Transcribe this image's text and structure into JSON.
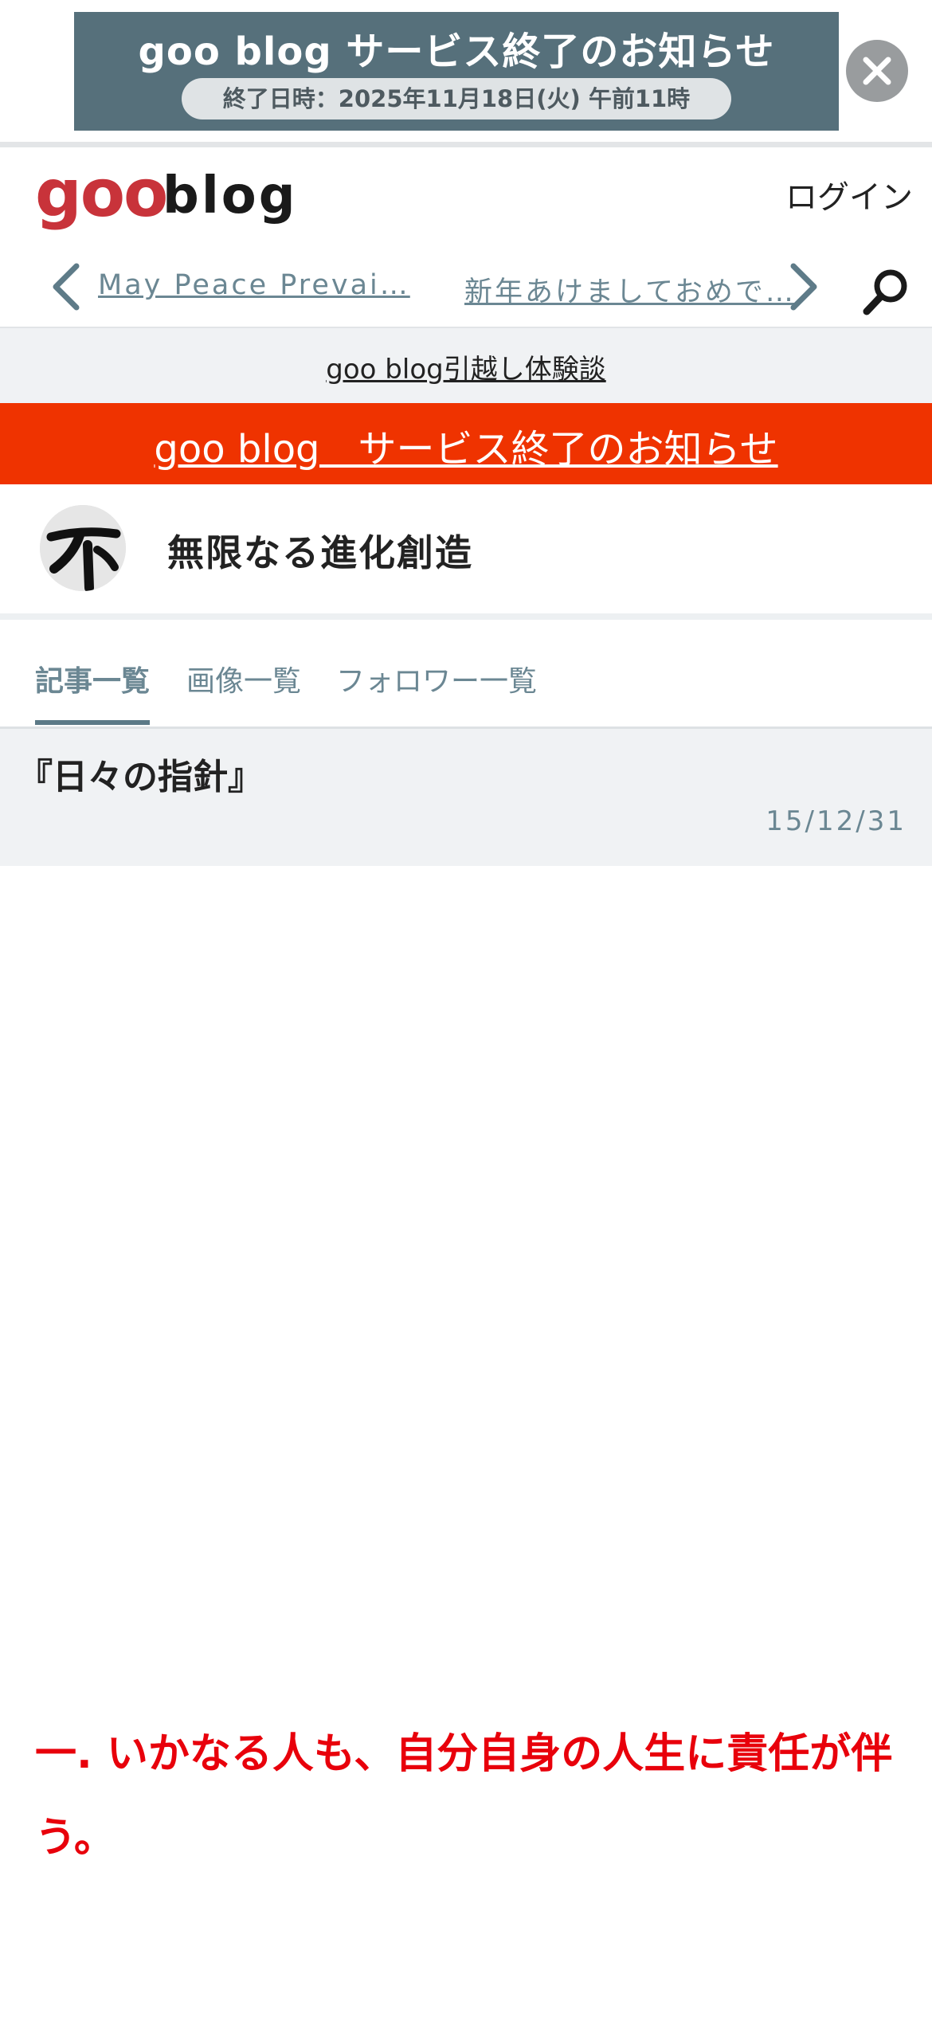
{
  "ad": {
    "title": "goo blog サービス終了のお知らせ",
    "subtitle": "終了日時：2025年11月18日(火) 午前11時",
    "close_icon": "close-icon"
  },
  "header": {
    "logo_goo": "goo",
    "logo_blog": "blog",
    "login": "ログイン"
  },
  "nav": {
    "prev": "May Peace Prevai…",
    "next": "新年あけましておめで…"
  },
  "notices": {
    "migration": "goo blog引越し体験談",
    "end_notice": "goo blog　サービス終了のお知らせ"
  },
  "blog": {
    "title": "無限なる進化創造"
  },
  "tabs": [
    {
      "label": "記事一覧",
      "active": true
    },
    {
      "label": "画像一覧",
      "active": false
    },
    {
      "label": "フォロワー一覧",
      "active": false
    }
  ],
  "entry": {
    "title": "『日々の指針』",
    "date": "15/12/31",
    "body_line": "一. いかなる人も、自分自身の人生に責任が伴う。"
  },
  "colors": {
    "accent_red": "#ef3300",
    "text_red": "#e8000b",
    "link_gray": "#6b8793",
    "logo_red": "#c8333a"
  }
}
